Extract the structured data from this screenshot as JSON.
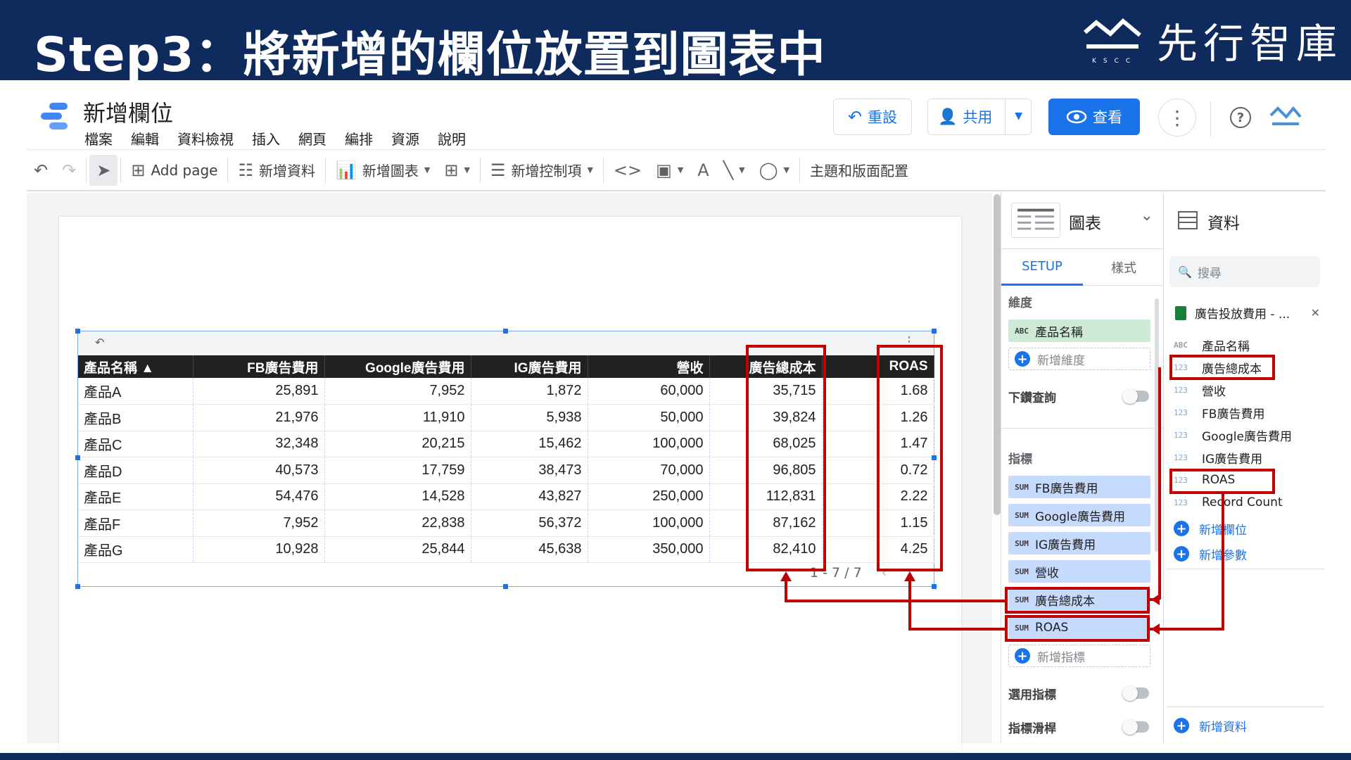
{
  "banner": {
    "title": "Step3：將新增的欄位放置到圖表中",
    "brand_name": "先行智庫",
    "brand_sub": "KSCC"
  },
  "app": {
    "title": "新增欄位",
    "menu": [
      "檔案",
      "編輯",
      "資料檢視",
      "插入",
      "網頁",
      "編排",
      "資源",
      "說明"
    ],
    "buttons": {
      "reset": "重設",
      "share": "共用",
      "view": "查看"
    }
  },
  "toolbar": {
    "add_page": "Add page",
    "add_data": "新增資料",
    "add_chart": "新增圖表",
    "add_control": "新增控制項",
    "theme": "主題和版面配置"
  },
  "table": {
    "columns": [
      "產品名稱 ▲",
      "FB廣告費用",
      "Google廣告費用",
      "IG廣告費用",
      "營收",
      "廣告總成本",
      "ROAS"
    ],
    "rows": [
      [
        "產品A",
        "25,891",
        "7,952",
        "1,872",
        "60,000",
        "35,715",
        "1.68"
      ],
      [
        "產品B",
        "21,976",
        "11,910",
        "5,938",
        "50,000",
        "39,824",
        "1.26"
      ],
      [
        "產品C",
        "32,348",
        "20,215",
        "15,462",
        "100,000",
        "68,025",
        "1.47"
      ],
      [
        "產品D",
        "40,573",
        "17,759",
        "38,473",
        "70,000",
        "96,805",
        "0.72"
      ],
      [
        "產品E",
        "54,476",
        "14,528",
        "43,827",
        "250,000",
        "112,831",
        "2.22"
      ],
      [
        "產品F",
        "7,952",
        "22,838",
        "56,372",
        "100,000",
        "87,162",
        "1.15"
      ],
      [
        "產品G",
        "10,928",
        "25,844",
        "45,638",
        "350,000",
        "82,410",
        "4.25"
      ]
    ],
    "pager": "1 - 7 / 7"
  },
  "chart_panel": {
    "title": "圖表",
    "tab_setup": "SETUP",
    "tab_style": "樣式",
    "dimension_label": "維度",
    "dimension_chip": {
      "tag": "ABC",
      "label": "產品名稱"
    },
    "add_dimension": "新增維度",
    "drilldown": "下鑽查詢",
    "metric_label": "指標",
    "metrics": [
      {
        "tag": "SUM",
        "label": "FB廣告費用"
      },
      {
        "tag": "SUM",
        "label": "Google廣告費用"
      },
      {
        "tag": "SUM",
        "label": "IG廣告費用"
      },
      {
        "tag": "SUM",
        "label": "營收"
      },
      {
        "tag": "SUM",
        "label": "廣告總成本"
      },
      {
        "tag": "SUM",
        "label": "ROAS"
      }
    ],
    "add_metric": "新增指標",
    "optional_metrics": "選用指標",
    "metric_slider": "指標滑桿"
  },
  "data_panel": {
    "title": "資料",
    "search_placeholder": "搜尋",
    "source": "廣告投放費用 - ...",
    "fields": [
      {
        "type": "ABC",
        "name": "產品名稱"
      },
      {
        "type": "123",
        "name": "廣告總成本"
      },
      {
        "type": "123",
        "name": "營收"
      },
      {
        "type": "123",
        "name": "FB廣告費用"
      },
      {
        "type": "123",
        "name": "Google廣告費用"
      },
      {
        "type": "123",
        "name": "IG廣告費用"
      },
      {
        "type": "123",
        "name": "ROAS"
      },
      {
        "type": "123",
        "name": "Record Count"
      }
    ],
    "add_field": "新增欄位",
    "add_param": "新增參數",
    "add_data": "新增資料"
  },
  "colors": {
    "banner": "#0f2a5c",
    "accent": "#1a73e8",
    "annotation": "#c00000"
  }
}
